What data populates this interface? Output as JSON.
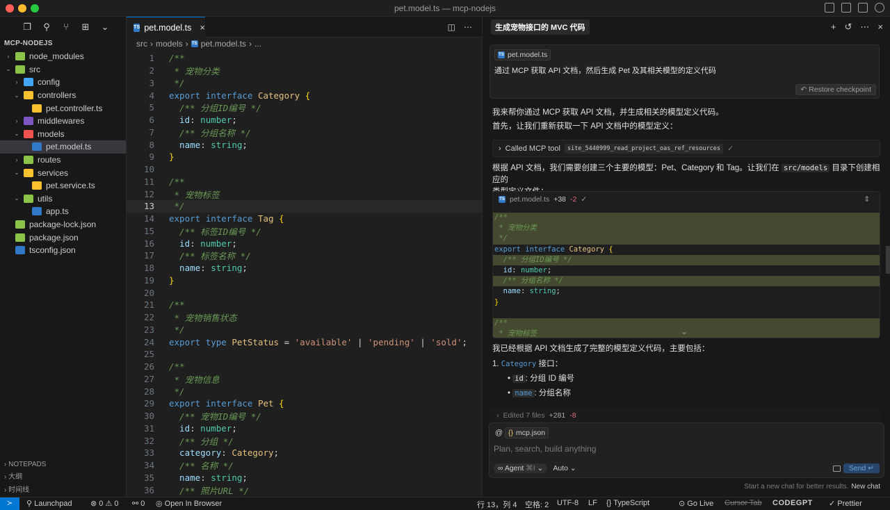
{
  "window": {
    "title": "pet.model.ts — mcp-nodejs"
  },
  "explorer": {
    "root": "MCP-NODEJS",
    "items": [
      {
        "label": "node_modules",
        "indent": 1,
        "chev": "›",
        "icon_color": "#8bc34a",
        "icon": "folder-icon"
      },
      {
        "label": "src",
        "indent": 1,
        "chev": "⌄",
        "icon_color": "#8bc34a",
        "icon": "folder-open-icon"
      },
      {
        "label": "config",
        "indent": 2,
        "chev": "›",
        "icon_color": "#42a5f5",
        "icon": "folder-icon"
      },
      {
        "label": "controllers",
        "indent": 2,
        "chev": "⌄",
        "icon_color": "#fbc02d",
        "icon": "folder-open-icon"
      },
      {
        "label": "pet.controller.ts",
        "indent": 3,
        "chev": "",
        "icon_color": "#fbc02d",
        "icon": "gear-file-icon"
      },
      {
        "label": "middlewares",
        "indent": 2,
        "chev": "›",
        "icon_color": "#7e57c2",
        "icon": "folder-icon"
      },
      {
        "label": "models",
        "indent": 2,
        "chev": "⌄",
        "icon_color": "#ef5350",
        "icon": "folder-open-icon"
      },
      {
        "label": "pet.model.ts",
        "indent": 3,
        "chev": "",
        "icon_color": "#3178c6",
        "icon": "ts-file-icon",
        "selected": true
      },
      {
        "label": "routes",
        "indent": 2,
        "chev": "›",
        "icon_color": "#8bc34a",
        "icon": "folder-icon"
      },
      {
        "label": "services",
        "indent": 2,
        "chev": "⌄",
        "icon_color": "#fbc02d",
        "icon": "folder-open-icon"
      },
      {
        "label": "pet.service.ts",
        "indent": 3,
        "chev": "",
        "icon_color": "#fbc02d",
        "icon": "service-file-icon"
      },
      {
        "label": "utils",
        "indent": 2,
        "chev": "⌄",
        "icon_color": "#8bc34a",
        "icon": "folder-open-icon"
      },
      {
        "label": "app.ts",
        "indent": 3,
        "chev": "",
        "icon_color": "#3178c6",
        "icon": "ts-file-icon"
      },
      {
        "label": "package-lock.json",
        "indent": 1,
        "chev": "",
        "icon_color": "#8bc34a",
        "icon": "json-file-icon"
      },
      {
        "label": "package.json",
        "indent": 1,
        "chev": "",
        "icon_color": "#8bc34a",
        "icon": "json-file-icon"
      },
      {
        "label": "tsconfig.json",
        "indent": 1,
        "chev": "",
        "icon_color": "#3178c6",
        "icon": "ts-config-icon"
      }
    ],
    "notepads": [
      "NOTEPADS",
      "大纲",
      "时间线"
    ]
  },
  "editor": {
    "tab_label": "pet.model.ts",
    "breadcrumb": [
      "src",
      "models",
      "pet.model.ts",
      "..."
    ],
    "current_line": 13,
    "lines": [
      [
        [
          "/**",
          "com"
        ]
      ],
      [
        [
          " * 宠物分类",
          "com"
        ]
      ],
      [
        [
          " */",
          "com"
        ]
      ],
      [
        [
          "export ",
          "kw"
        ],
        [
          "interface ",
          "kw"
        ],
        [
          "Category",
          "cls"
        ],
        [
          " {",
          "br"
        ]
      ],
      [
        [
          "  /** 分组ID编号 */",
          "com"
        ]
      ],
      [
        [
          "  id",
          "pr"
        ],
        [
          ": ",
          "pun"
        ],
        [
          "number",
          "ty"
        ],
        [
          ";",
          "pun"
        ]
      ],
      [
        [
          "  /** 分组名称 */",
          "com"
        ]
      ],
      [
        [
          "  name",
          "pr"
        ],
        [
          ": ",
          "pun"
        ],
        [
          "string",
          "ty"
        ],
        [
          ";",
          "pun"
        ]
      ],
      [
        [
          "}",
          "br"
        ]
      ],
      [],
      [
        [
          "/**",
          "com"
        ]
      ],
      [
        [
          " * 宠物标签",
          "com"
        ]
      ],
      [
        [
          " */",
          "com"
        ]
      ],
      [
        [
          "export ",
          "kw"
        ],
        [
          "interface ",
          "kw"
        ],
        [
          "Tag",
          "cls"
        ],
        [
          " {",
          "br"
        ]
      ],
      [
        [
          "  /** 标签ID编号 */",
          "com"
        ]
      ],
      [
        [
          "  id",
          "pr"
        ],
        [
          ": ",
          "pun"
        ],
        [
          "number",
          "ty"
        ],
        [
          ";",
          "pun"
        ]
      ],
      [
        [
          "  /** 标签名称 */",
          "com"
        ]
      ],
      [
        [
          "  name",
          "pr"
        ],
        [
          ": ",
          "pun"
        ],
        [
          "string",
          "ty"
        ],
        [
          ";",
          "pun"
        ]
      ],
      [
        [
          "}",
          "br"
        ]
      ],
      [],
      [
        [
          "/**",
          "com"
        ]
      ],
      [
        [
          " * 宠物销售状态",
          "com"
        ]
      ],
      [
        [
          " */",
          "com"
        ]
      ],
      [
        [
          "export ",
          "kw"
        ],
        [
          "type ",
          "kw"
        ],
        [
          "PetStatus",
          "cls"
        ],
        [
          " = ",
          "pun"
        ],
        [
          "'available'",
          "str"
        ],
        [
          " | ",
          "pun"
        ],
        [
          "'pending'",
          "str"
        ],
        [
          " | ",
          "pun"
        ],
        [
          "'sold'",
          "str"
        ],
        [
          ";",
          "pun"
        ]
      ],
      [],
      [
        [
          "/**",
          "com"
        ]
      ],
      [
        [
          " * 宠物信息",
          "com"
        ]
      ],
      [
        [
          " */",
          "com"
        ]
      ],
      [
        [
          "export ",
          "kw"
        ],
        [
          "interface ",
          "kw"
        ],
        [
          "Pet",
          "cls"
        ],
        [
          " {",
          "br"
        ]
      ],
      [
        [
          "  /** 宠物ID编号 */",
          "com"
        ]
      ],
      [
        [
          "  id",
          "pr"
        ],
        [
          ": ",
          "pun"
        ],
        [
          "number",
          "ty"
        ],
        [
          ";",
          "pun"
        ]
      ],
      [
        [
          "  /** 分组 */",
          "com"
        ]
      ],
      [
        [
          "  category",
          "pr"
        ],
        [
          ": ",
          "pun"
        ],
        [
          "Category",
          "cls"
        ],
        [
          ";",
          "pun"
        ]
      ],
      [
        [
          "  /** 名称 */",
          "com"
        ]
      ],
      [
        [
          "  name",
          "pr"
        ],
        [
          ": ",
          "pun"
        ],
        [
          "string",
          "ty"
        ],
        [
          ";",
          "pun"
        ]
      ],
      [
        [
          "  /** 照片URL */",
          "com"
        ]
      ]
    ]
  },
  "chat": {
    "title": "生成宠物接口的 MVC 代码",
    "request": {
      "file_pill": "pet.model.ts",
      "text": "通过 MCP 获取 API 文档，然后生成 Pet 及其相关模型的定义代码",
      "restore": "Restore checkpoint"
    },
    "msg1": "我来帮你通过 MCP 获取 API 文档，并生成相关的模型定义代码。",
    "msg2": "首先，让我们重新获取一下 API 文档中的模型定义：",
    "tool_label": "Called MCP tool",
    "tool_name": "site_5440999_read_project_oas_ref_resources",
    "msg3a": "根据 API 文档，我们需要创建三个主要的模型：Pet、Category 和 Tag。让我们在",
    "msg3_code": "src/models",
    "msg3b": "目录下创建相应的",
    "msg3c": "类型定义文件：",
    "diff": {
      "file": "pet.model.ts",
      "added": "+38",
      "removed": "-2",
      "lines": [
        {
          "parts": [
            [
              "/**",
              "com"
            ]
          ],
          "add": true
        },
        {
          "parts": [
            [
              " * 宠物分类",
              "com"
            ]
          ],
          "add": true
        },
        {
          "parts": [
            [
              " */",
              "com"
            ]
          ],
          "add": true
        },
        {
          "parts": [
            [
              "export ",
              "kw"
            ],
            [
              "interface ",
              "kw"
            ],
            [
              "Category",
              "cls"
            ],
            [
              " {",
              "br"
            ]
          ],
          "add": false
        },
        {
          "parts": [
            [
              "  /** 分组ID编号 */",
              "com"
            ]
          ],
          "add": true
        },
        {
          "parts": [
            [
              "  id",
              "pr"
            ],
            [
              ": ",
              "pun"
            ],
            [
              "number",
              "ty"
            ],
            [
              ";",
              "pun"
            ]
          ],
          "add": false
        },
        {
          "parts": [
            [
              "  /** 分组名称 */",
              "com"
            ]
          ],
          "add": true
        },
        {
          "parts": [
            [
              "  name",
              "pr"
            ],
            [
              ": ",
              "pun"
            ],
            [
              "string",
              "ty"
            ],
            [
              ";",
              "pun"
            ]
          ],
          "add": false
        },
        {
          "parts": [
            [
              "}",
              "br"
            ]
          ],
          "add": false
        },
        {
          "parts": [],
          "add": false
        },
        {
          "parts": [
            [
              "/**",
              "com"
            ]
          ],
          "add": true
        },
        {
          "parts": [
            [
              " * 宠物标签",
              "com"
            ]
          ],
          "add": true
        }
      ]
    },
    "summary": "我已经根据 API 文档生成了完整的模型定义代码，主要包括：",
    "list": {
      "num": "1.",
      "code": "Category",
      "text": " 接口：",
      "items": [
        {
          "code": "id",
          "text": ": 分组 ID 编号"
        },
        {
          "code": "name",
          "text": ": 分组名称"
        }
      ]
    },
    "edited": {
      "label": "Edited 7 files",
      "added": "+281",
      "removed": "-8"
    },
    "input": {
      "at": "@",
      "pill": "mcp.json",
      "placeholder": "Plan, search, build anything",
      "agent": "Agent",
      "shortcut": "⌘I",
      "mode": "Auto",
      "send": "Send"
    },
    "new_chat_hint": "Start a new chat for better results.",
    "new_chat": "New chat"
  },
  "status": {
    "remote": "≻",
    "launchpad": "Launchpad",
    "errors": "⊗ 0 ⚠ 0",
    "ports": "⚯ 0",
    "browser": "Open In Browser",
    "position": "行 13，列 4",
    "spaces": "空格: 2",
    "encoding": "UTF-8",
    "eol": "LF",
    "language": "{} TypeScript",
    "golive": "Go Live",
    "cursortab": "Cursor Tab",
    "codegpt": "CODEGPT",
    "prettier": "✓ Prettier"
  },
  "colors": {
    "accent": "#0078d4",
    "diff_add": "#45492f",
    "send": "#26476b"
  }
}
